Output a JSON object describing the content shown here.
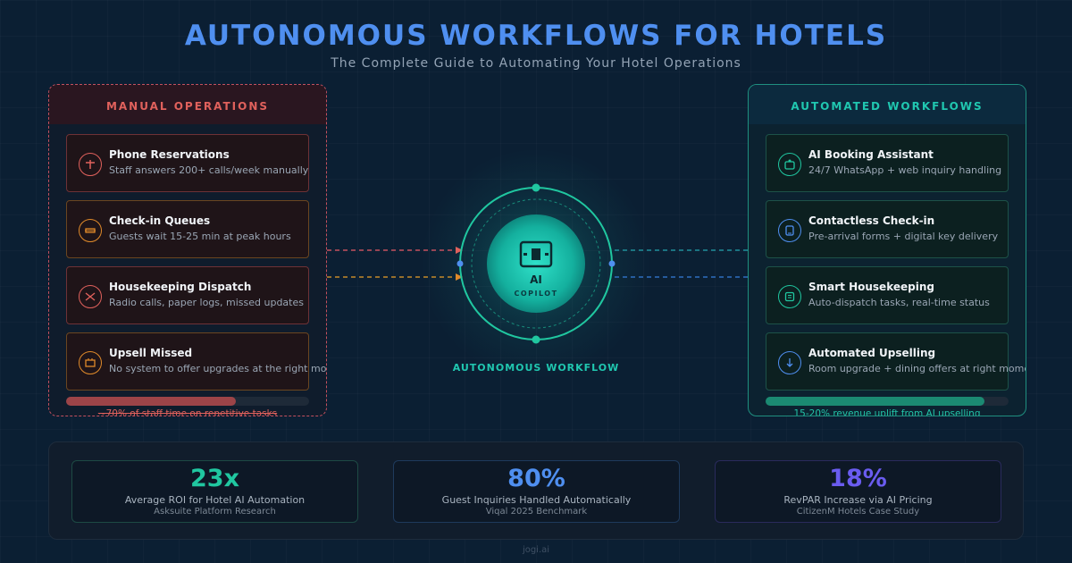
{
  "header": {
    "title": "AUTONOMOUS WORKFLOWS FOR HOTELS",
    "subtitle": "The Complete Guide to Automating Your Hotel Operations"
  },
  "manual": {
    "title": "MANUAL OPERATIONS",
    "items": [
      {
        "icon": "phone-icon",
        "title": "Phone Reservations",
        "desc": "Staff answers 200+ calls/week manually",
        "color": "#e0615c"
      },
      {
        "icon": "queue-icon",
        "title": "Check-in Queues",
        "desc": "Guests wait 15-25 min at peak hours",
        "color": "#e08a2a"
      },
      {
        "icon": "dispatch-icon",
        "title": "Housekeeping Dispatch",
        "desc": "Radio calls, paper logs, missed updates",
        "color": "#e0615c"
      },
      {
        "icon": "upsell-icon",
        "title": "Upsell Missed",
        "desc": "No system to offer upgrades at the right moment",
        "color": "#e08a2a"
      }
    ],
    "progress": 0.7,
    "caption": "~70% of staff time on repetitive tasks"
  },
  "automated": {
    "title": "AUTOMATED WORKFLOWS",
    "items": [
      {
        "icon": "booking-assistant-icon",
        "title": "AI Booking Assistant",
        "desc": "24/7 WhatsApp + web inquiry handling",
        "color": "#20c7a0"
      },
      {
        "icon": "contactless-checkin-icon",
        "title": "Contactless Check-in",
        "desc": "Pre-arrival forms + digital key delivery",
        "color": "#4f8ff0"
      },
      {
        "icon": "smart-housekeeping-icon",
        "title": "Smart Housekeeping",
        "desc": "Auto-dispatch tasks, real-time status",
        "color": "#20c7a0"
      },
      {
        "icon": "automated-upselling-icon",
        "title": "Automated Upselling",
        "desc": "Room upgrade + dining offers at right moments",
        "color": "#4f8ff0"
      }
    ],
    "progress": 0.9,
    "caption": "15-20% revenue uplift from AI upselling"
  },
  "center": {
    "ai": "AI",
    "copilot": "COPILOT",
    "caption": "AUTONOMOUS WORKFLOW",
    "icon": "ai-chip-icon"
  },
  "stats": [
    {
      "value": "23x",
      "label": "Average ROI for Hotel AI Automation",
      "source": "Asksuite Platform Research",
      "color": "#20c7a0"
    },
    {
      "value": "80%",
      "label": "Guest Inquiries Handled Automatically",
      "source": "Viqal 2025 Benchmark",
      "color": "#4f8ff0"
    },
    {
      "value": "18%",
      "label": "RevPAR Increase via AI Pricing",
      "source": "CitizenM Hotels Case Study",
      "color": "#6a5cf0"
    }
  ],
  "footer": "jogi.ai",
  "colors": {
    "background": "#0b1f33",
    "accent_blue": "#4f8ff0",
    "accent_teal": "#20c7b0",
    "accent_red": "#e0615c",
    "accent_orange": "#e08a2a"
  }
}
